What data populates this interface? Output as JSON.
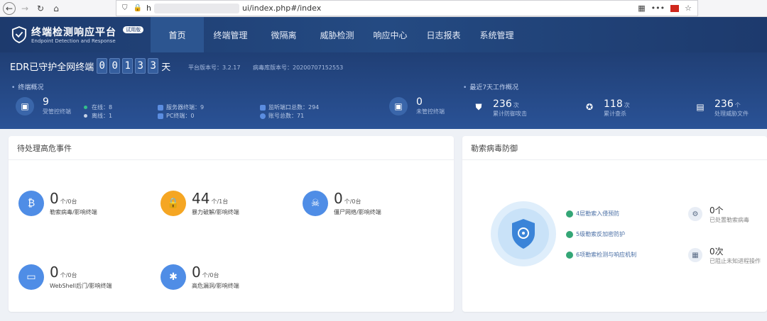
{
  "browser": {
    "url_host": "h",
    "url_path": "ui/index.php#/index"
  },
  "app": {
    "title": "终端检测响应平台",
    "subtitle": "Endpoint Detection and Response",
    "tag": "试用版"
  },
  "nav": {
    "items": [
      "首页",
      "终端管理",
      "微隔离",
      "威胁检测",
      "响应中心",
      "日志报表",
      "系统管理"
    ]
  },
  "status": {
    "edr_label": "EDR已守护全网终端",
    "digits": [
      "0",
      "0",
      "1",
      "3",
      "3"
    ],
    "edr_unit": "天",
    "platform_version_label": "平台版本号：3.2.17",
    "virus_db_label": "病毒库版本号：20200707152553",
    "terminal_overview_label": "终端概况",
    "recent_label": "最近7天工作概况",
    "managed": {
      "num": "9",
      "label": "受管控终端"
    },
    "online": "在线：8",
    "offline": "离线：1",
    "servers": "服务器终端：9",
    "pcs": "PC终端：0",
    "ports": "监听端口总数：294",
    "accounts": "账号总数：71",
    "unmanaged": {
      "num": "0",
      "label": "未管控终端"
    },
    "attacks": {
      "num": "236",
      "unit": "次",
      "label": "累计防御攻击"
    },
    "kills": {
      "num": "118",
      "unit": "次",
      "label": "累计查杀"
    },
    "files": {
      "num": "236",
      "unit": "个",
      "label": "处理威胁文件"
    }
  },
  "events": {
    "title": "待处理高危事件",
    "cards": [
      {
        "num": "0",
        "unit": "个/0台",
        "desc": "勒索病毒/影响终端"
      },
      {
        "num": "44",
        "unit": "个/1台",
        "desc": "暴力破解/影响终端"
      },
      {
        "num": "0",
        "unit": "个/0台",
        "desc": "僵尸网络/影响终端"
      },
      {
        "num": "0",
        "unit": "个/0台",
        "desc": "WebShell后门/影响终端"
      },
      {
        "num": "0",
        "unit": "个/0台",
        "desc": "高危漏洞/影响终端"
      }
    ]
  },
  "ransom": {
    "title": "勒索病毒防御",
    "features": [
      "4层勒索入侵预防",
      "5级勒索反加密防护",
      "6项勒索检测与响应机制"
    ],
    "handled": {
      "num": "0个",
      "label": "已处置勒索病毒"
    },
    "blocked": {
      "num": "0次",
      "label": "已阻止未知进程操作"
    }
  },
  "colors": {
    "header": "#1d3a6d",
    "accent_blue": "#3b6fd0",
    "accent_orange": "#f5a623",
    "green": "#34a676"
  }
}
